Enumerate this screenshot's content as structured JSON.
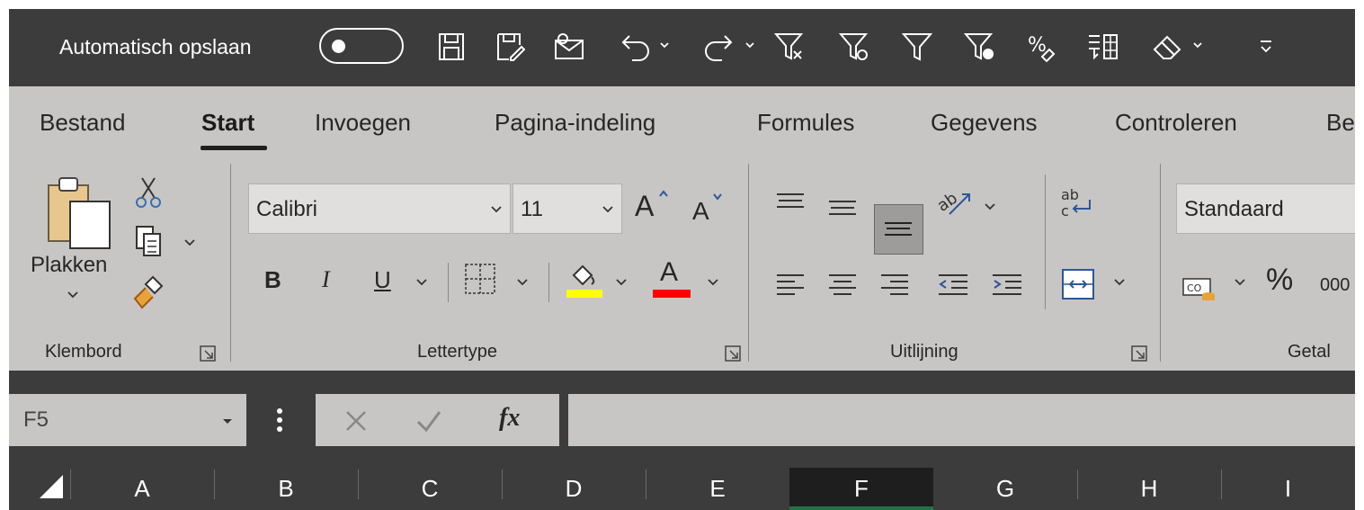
{
  "qat": {
    "autosave_label": "Automatisch opslaan",
    "icons": [
      "save-icon",
      "save-as-icon",
      "email-icon",
      "undo-icon",
      "redo-icon",
      "clear-filter-icon",
      "reapply-filter-icon",
      "filter-icon",
      "advanced-filter-icon",
      "percent-style-icon",
      "text-to-columns-icon",
      "clear-icon",
      "customize-qat-icon"
    ]
  },
  "tabs": [
    "Bestand",
    "Start",
    "Invoegen",
    "Pagina-indeling",
    "Formules",
    "Gegevens",
    "Controleren",
    "Be"
  ],
  "active_tab": "Start",
  "clipboard": {
    "paste_label": "Plakken",
    "group_label": "Klembord"
  },
  "font": {
    "name": "Calibri",
    "size": "11",
    "bold": "B",
    "italic": "I",
    "underline": "U",
    "grow": "A",
    "shrink": "A",
    "font_color": "A",
    "group_label": "Lettertype",
    "highlight_color": "#ffff00",
    "text_color": "#ff0000"
  },
  "alignment": {
    "wrap_label": "ab",
    "group_label": "Uitlijning"
  },
  "number": {
    "format": "Standaard",
    "percent": "%",
    "comma": "000",
    "group_label": "Getal"
  },
  "formula_bar": {
    "name_box": "F5",
    "fx": "fx",
    "value": ""
  },
  "columns": [
    "A",
    "B",
    "C",
    "D",
    "E",
    "F",
    "G",
    "H",
    "I"
  ],
  "active_column": "F",
  "colors": {
    "qat_bg": "#3c3c3c",
    "ribbon_bg": "#c8c6c4",
    "accent": "#217346"
  }
}
